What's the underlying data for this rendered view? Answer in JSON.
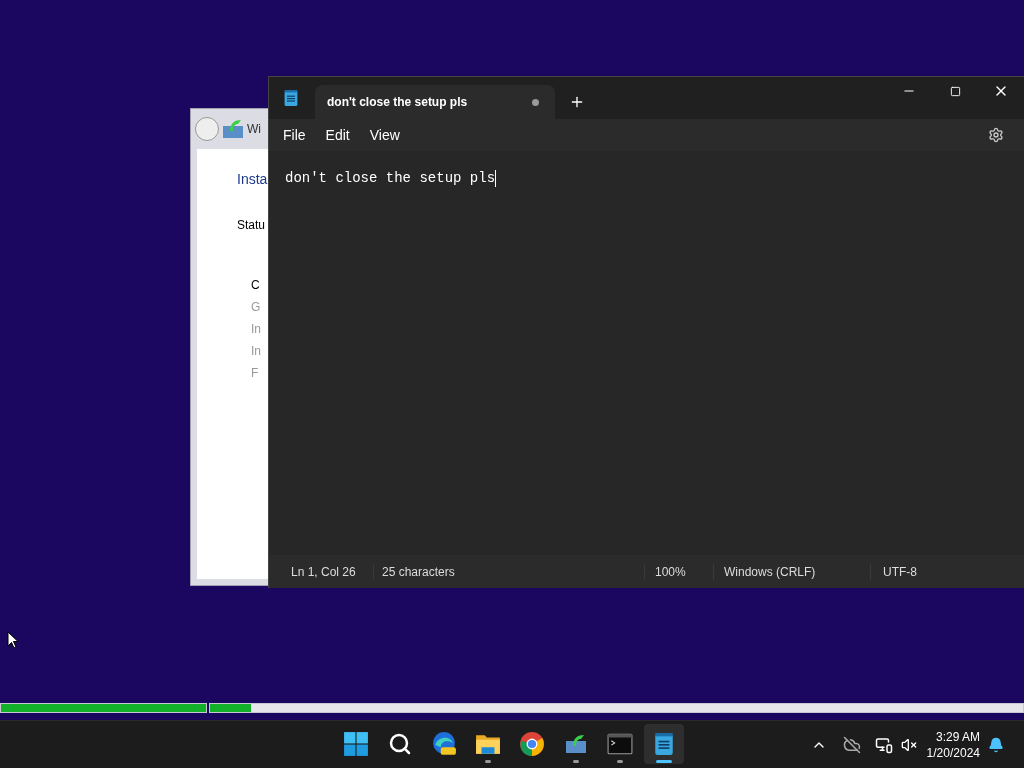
{
  "setup_window": {
    "title": "Wi",
    "heading": "Insta",
    "status": "Statu",
    "group_title": "C",
    "steps": [
      "G",
      "In",
      "In",
      "F"
    ]
  },
  "notepad": {
    "tabs": [
      {
        "title": "don't close the setup pls",
        "unsaved": true,
        "selected": true
      }
    ],
    "menu": [
      "File",
      "Edit",
      "View"
    ],
    "content": "don't close the setup pls",
    "status": {
      "position": "Ln 1, Col 26",
      "characters": "25 characters",
      "zoom": "100%",
      "line_ending": "Windows (CRLF)",
      "encoding": "UTF-8"
    }
  },
  "progress": {
    "segments": [
      {
        "level": 1
      },
      {
        "level": 0.05
      }
    ]
  },
  "taskbar": {
    "apps": [
      {
        "kind": "start",
        "running": false,
        "selected": false
      },
      {
        "kind": "search",
        "running": false,
        "selected": false
      },
      {
        "kind": "edge",
        "running": false,
        "selected": false
      },
      {
        "kind": "explorer",
        "running": true,
        "selected": false
      },
      {
        "kind": "chrome",
        "running": false,
        "selected": false
      },
      {
        "kind": "setup",
        "running": true,
        "selected": false
      },
      {
        "kind": "terminal",
        "running": true,
        "selected": false
      },
      {
        "kind": "notepad",
        "running": true,
        "selected": true
      }
    ],
    "clock": {
      "time": "3:29 AM",
      "date": "1/20/2024"
    }
  }
}
